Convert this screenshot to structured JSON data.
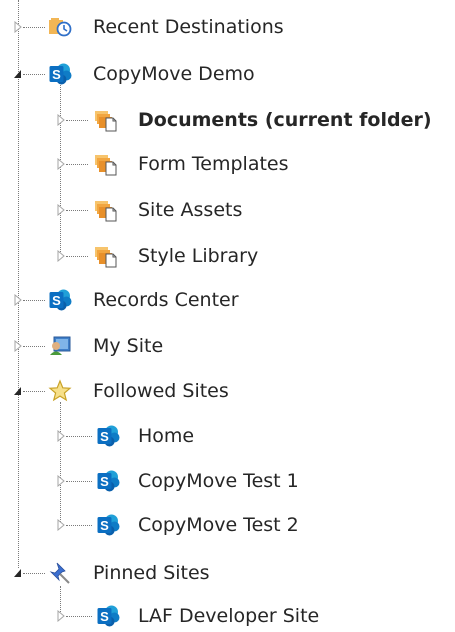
{
  "tree": {
    "recent_destinations": {
      "label": "Recent Destinations",
      "icon": "recent-destinations-icon",
      "state": "collapsed"
    },
    "copymove_demo": {
      "label": "CopyMove Demo",
      "icon": "sharepoint-site-icon",
      "state": "expanded",
      "children": [
        {
          "label": "Documents (current folder)",
          "icon": "library-icon",
          "state": "collapsed",
          "current": true
        },
        {
          "label": "Form Templates",
          "icon": "library-icon",
          "state": "collapsed"
        },
        {
          "label": "Site Assets",
          "icon": "library-icon",
          "state": "collapsed"
        },
        {
          "label": "Style Library",
          "icon": "library-icon",
          "state": "collapsed"
        }
      ]
    },
    "records_center": {
      "label": "Records Center",
      "icon": "sharepoint-site-icon",
      "state": "collapsed"
    },
    "my_site": {
      "label": "My Site",
      "icon": "my-site-icon",
      "state": "collapsed"
    },
    "followed_sites": {
      "label": "Followed Sites",
      "icon": "star-icon",
      "state": "expanded",
      "children": [
        {
          "label": "Home",
          "icon": "sharepoint-site-icon",
          "state": "collapsed"
        },
        {
          "label": "CopyMove Test 1",
          "icon": "sharepoint-site-icon",
          "state": "collapsed"
        },
        {
          "label": "CopyMove Test 2",
          "icon": "sharepoint-site-icon",
          "state": "collapsed"
        }
      ]
    },
    "pinned_sites": {
      "label": "Pinned Sites",
      "icon": "pin-icon",
      "state": "expanded",
      "children": [
        {
          "label": "LAF Developer Site",
          "icon": "sharepoint-site-icon",
          "state": "collapsed"
        }
      ]
    }
  },
  "colors": {
    "text": "#262626",
    "tree_line": "#7a7a7a",
    "sharepoint_blue": "#0b6fc2",
    "library_orange": "#f2a640",
    "star_yellow": "#f5c542",
    "pin_blue": "#3b6fd1"
  }
}
